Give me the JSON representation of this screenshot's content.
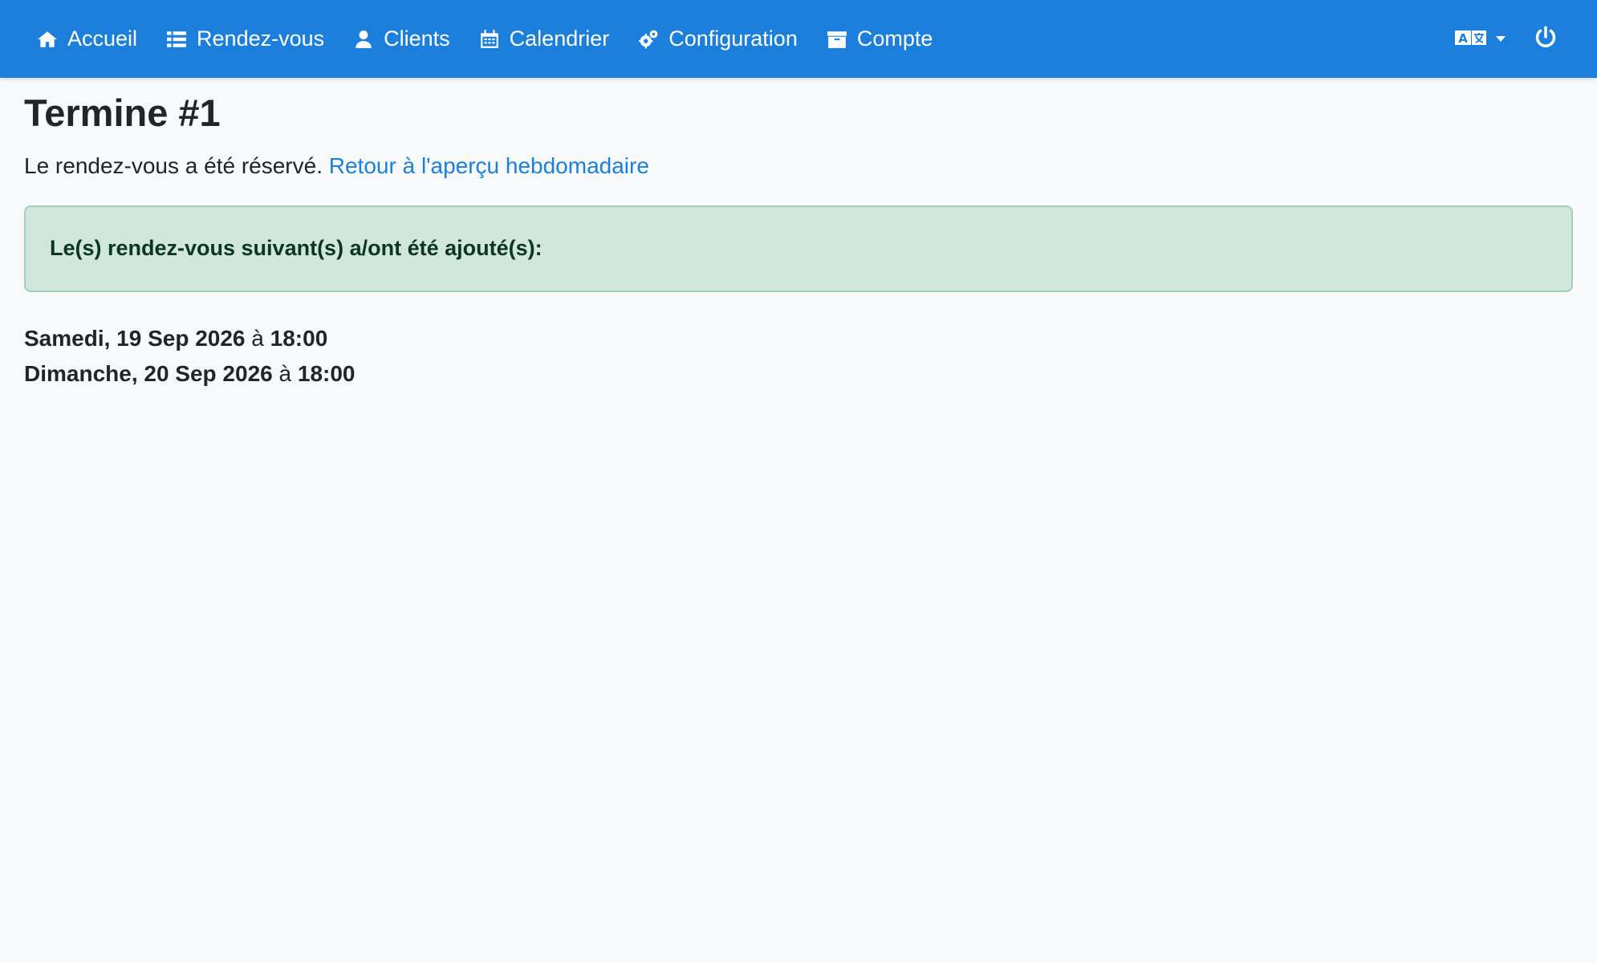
{
  "nav": {
    "items": [
      {
        "label": "Accueil",
        "icon": "home-icon"
      },
      {
        "label": "Rendez-vous",
        "icon": "list-icon"
      },
      {
        "label": "Clients",
        "icon": "user-icon"
      },
      {
        "label": "Calendrier",
        "icon": "calendar-icon"
      },
      {
        "label": "Configuration",
        "icon": "gears-icon"
      },
      {
        "label": "Compte",
        "icon": "archive-icon"
      }
    ],
    "language_icon": "translate-icon",
    "logout_icon": "power-icon"
  },
  "page": {
    "title": "Termine #1",
    "message": "Le rendez-vous a été réservé.",
    "back_link": "Retour à l'aperçu hebdomadaire"
  },
  "alert": {
    "text": "Le(s) rendez-vous suivant(s) a/ont été ajouté(s):"
  },
  "appointments": [
    {
      "date": "Samedi, 19 Sep 2026",
      "at": "à",
      "time": "18:00"
    },
    {
      "date": "Dimanche, 20 Sep 2026",
      "at": "à",
      "time": "18:00"
    }
  ],
  "colors": {
    "navbar": "#1b7fdb",
    "alert_bg": "#d1e7dd",
    "alert_text": "#0a3622",
    "link": "#1b7fdb"
  }
}
